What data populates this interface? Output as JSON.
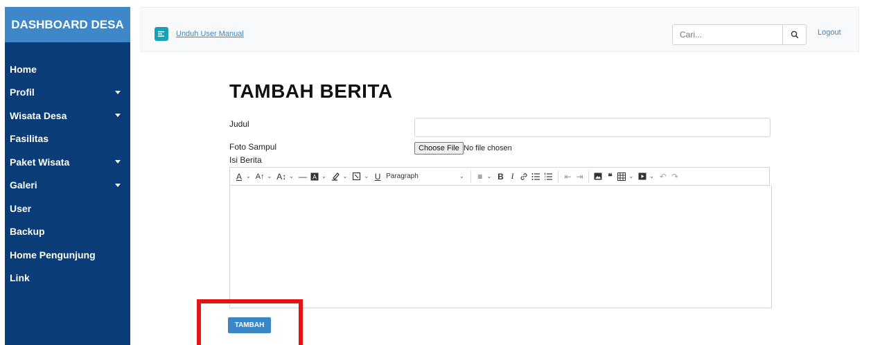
{
  "sidebar": {
    "brand": "DASHBOARD DESA",
    "items": [
      {
        "label": "Home",
        "has_submenu": false
      },
      {
        "label": "Profil",
        "has_submenu": true
      },
      {
        "label": "Wisata Desa",
        "has_submenu": true
      },
      {
        "label": "Fasilitas",
        "has_submenu": false
      },
      {
        "label": "Paket Wisata",
        "has_submenu": true
      },
      {
        "label": "Galeri",
        "has_submenu": true
      },
      {
        "label": "User",
        "has_submenu": false
      },
      {
        "label": "Backup",
        "has_submenu": false
      },
      {
        "label": "Home Pengunjung",
        "has_submenu": false
      },
      {
        "label": "Link",
        "has_submenu": false
      }
    ]
  },
  "topbar": {
    "menu_icon": "hamburger-icon",
    "manual_link": "Unduh User Manual",
    "search_placeholder": "Cari...",
    "search_icon": "search-icon",
    "logout": "Logout"
  },
  "form": {
    "title": "TAMBAH BERITA",
    "judul_label": "Judul",
    "judul_value": "",
    "foto_label": "Foto Sampul",
    "file_button": "Choose File",
    "file_status": "No file chosen",
    "isi_label": "Isi Berita",
    "paragraph_select": "Paragraph",
    "submit": "TAMBAH"
  },
  "colors": {
    "sidebar_bg": "#0a3c78",
    "brand_bg": "#3e88c9",
    "accent": "#3a87c8",
    "menu_button": "#17a2b8",
    "highlight": "#e51313"
  }
}
